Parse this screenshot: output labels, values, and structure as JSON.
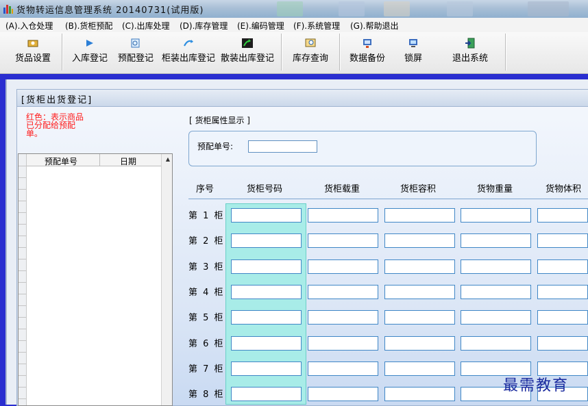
{
  "window": {
    "title": "货物转运信息管理系统 20140731(试用版)"
  },
  "menu": [
    {
      "label": "(A).入仓处理"
    },
    {
      "label": "(B).货柜预配"
    },
    {
      "label": "(C).出库处理"
    },
    {
      "label": "(D).库存管理"
    },
    {
      "label": "(E).编码管理"
    },
    {
      "label": "(F).系统管理"
    },
    {
      "label": "(G).帮助退出"
    }
  ],
  "toolbar": [
    {
      "label": "货品设置",
      "icon": "goods-settings-icon"
    },
    {
      "label": "入库登记",
      "icon": "inbound-icon"
    },
    {
      "label": "预配登记",
      "icon": "preassign-icon"
    },
    {
      "label": "柜装出库登记",
      "icon": "container-out-icon"
    },
    {
      "label": "散装出库登记",
      "icon": "bulk-out-icon"
    },
    {
      "label": "库存查询",
      "icon": "stock-query-icon"
    },
    {
      "label": "数据备份",
      "icon": "backup-icon"
    },
    {
      "label": "锁屏",
      "icon": "lock-screen-icon"
    },
    {
      "label": "退出系统",
      "icon": "exit-icon"
    }
  ],
  "child_window": {
    "title": "[货柜出货登记]",
    "note": "红色：表示商品已分配给预配单。",
    "list": {
      "columns": [
        "预配单号",
        "日期"
      ]
    },
    "group": {
      "title": "[ 货柜属性显示 ]",
      "preassign_label": "预配单号:",
      "preassign_value": ""
    },
    "grid": {
      "columns": [
        "序号",
        "货柜号码",
        "货柜载重",
        "货柜容积",
        "货物重量",
        "货物体积"
      ],
      "rows": [
        {
          "label": "第 1 柜"
        },
        {
          "label": "第 2 柜"
        },
        {
          "label": "第 3 柜"
        },
        {
          "label": "第 4 柜"
        },
        {
          "label": "第 5 柜"
        },
        {
          "label": "第 6 柜"
        },
        {
          "label": "第 7 柜"
        },
        {
          "label": "第 8 柜"
        }
      ]
    }
  },
  "watermark": "最需教育",
  "colors": {
    "accent_blue": "#2a2ed0",
    "note_red": "#ff1a1a",
    "highlight_cyan": "#a8ece8"
  }
}
